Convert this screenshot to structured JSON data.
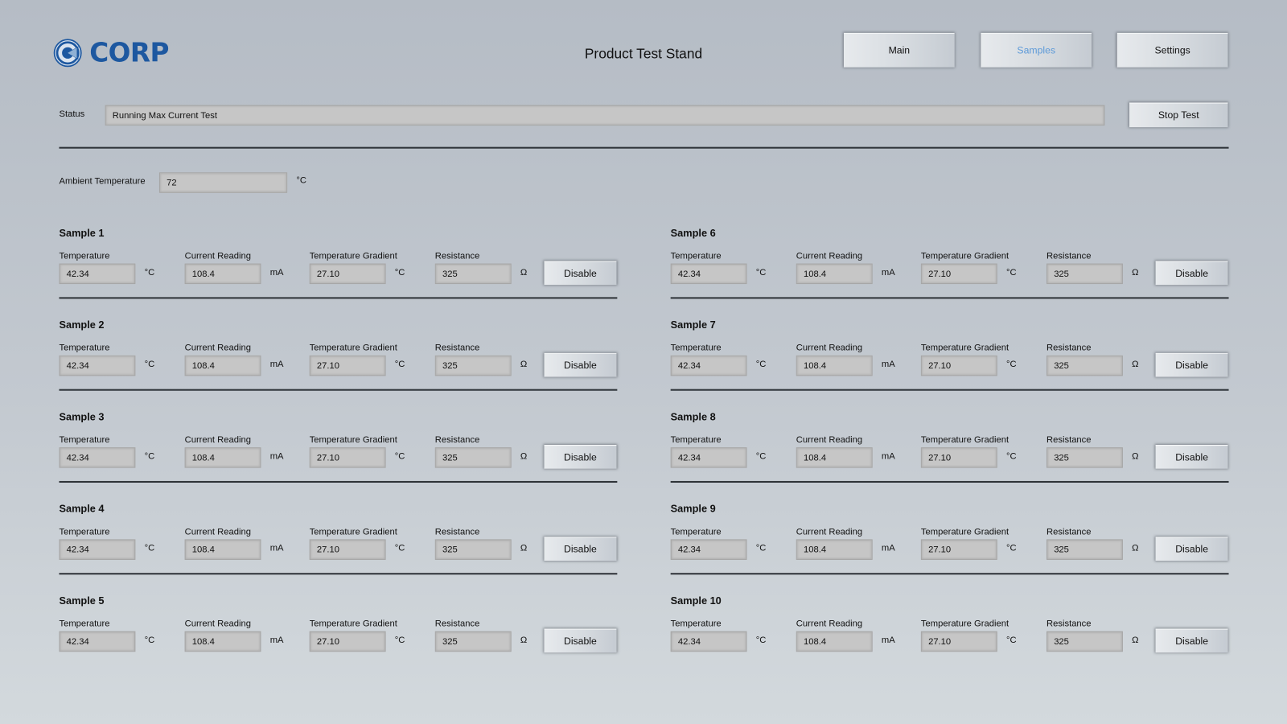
{
  "header": {
    "logo_text": "CORP",
    "title": "Product Test Stand",
    "nav": [
      {
        "label": "Main",
        "active": false
      },
      {
        "label": "Samples",
        "active": true
      },
      {
        "label": "Settings",
        "active": false
      }
    ]
  },
  "status": {
    "label": "Status",
    "value": "Running Max Current Test",
    "stop_button": "Stop Test"
  },
  "ambient": {
    "label": "Ambient Temperature",
    "value": "72",
    "unit": "°C"
  },
  "field_labels": {
    "temperature": "Temperature",
    "current": "Current Reading",
    "gradient": "Temperature Gradient",
    "resistance": "Resistance"
  },
  "units": {
    "temperature": "°C",
    "current": "mA",
    "gradient": "°C",
    "resistance": "Ω"
  },
  "disable_label": "Disable",
  "samples": [
    {
      "title": "Sample 1",
      "temperature": "42.34",
      "current": "108.4",
      "gradient": "27.10",
      "resistance": "325"
    },
    {
      "title": "Sample 2",
      "temperature": "42.34",
      "current": "108.4",
      "gradient": "27.10",
      "resistance": "325"
    },
    {
      "title": "Sample 3",
      "temperature": "42.34",
      "current": "108.4",
      "gradient": "27.10",
      "resistance": "325"
    },
    {
      "title": "Sample 4",
      "temperature": "42.34",
      "current": "108.4",
      "gradient": "27.10",
      "resistance": "325"
    },
    {
      "title": "Sample 5",
      "temperature": "42.34",
      "current": "108.4",
      "gradient": "27.10",
      "resistance": "325"
    },
    {
      "title": "Sample 6",
      "temperature": "42.34",
      "current": "108.4",
      "gradient": "27.10",
      "resistance": "325"
    },
    {
      "title": "Sample 7",
      "temperature": "42.34",
      "current": "108.4",
      "gradient": "27.10",
      "resistance": "325"
    },
    {
      "title": "Sample 8",
      "temperature": "42.34",
      "current": "108.4",
      "gradient": "27.10",
      "resistance": "325"
    },
    {
      "title": "Sample 9",
      "temperature": "42.34",
      "current": "108.4",
      "gradient": "27.10",
      "resistance": "325"
    },
    {
      "title": "Sample 10",
      "temperature": "42.34",
      "current": "108.4",
      "gradient": "27.10",
      "resistance": "325"
    }
  ],
  "colors": {
    "brand": "#1d58a0",
    "active_nav": "#5d9ad8"
  }
}
